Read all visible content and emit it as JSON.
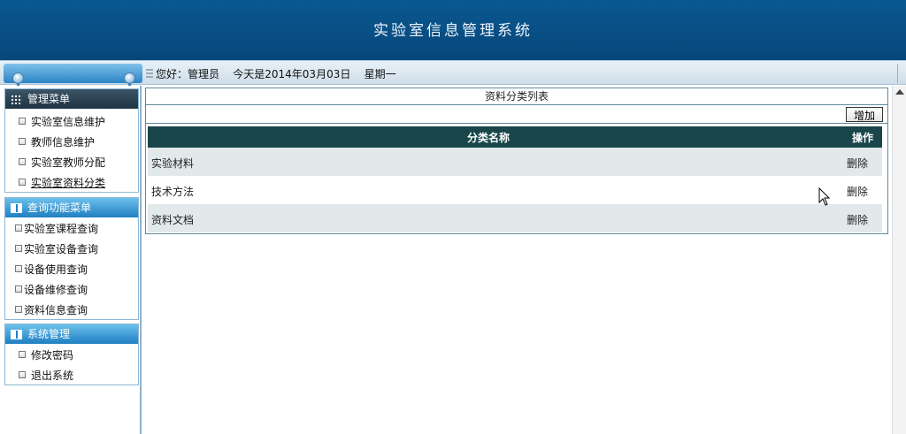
{
  "header": {
    "title": "实验室信息管理系统"
  },
  "welcome": {
    "text": "您好：管理员    今天是2014年03月03日    星期一"
  },
  "sidebar": {
    "admin_menu": {
      "title": "管理菜单",
      "items": [
        "实验室信息维护",
        "教师信息维护",
        "实验室教师分配",
        "实验室资料分类"
      ]
    },
    "query_menu": {
      "title": "查询功能菜单",
      "items": [
        "实验室课程查询",
        "实验室设备查询",
        "设备使用查询",
        "设备维修查询",
        "资料信息查询"
      ]
    },
    "system_menu": {
      "title": "系统管理",
      "items": [
        "修改密码",
        "退出系统"
      ]
    }
  },
  "panel": {
    "title": "资料分类列表",
    "add_label": "增加",
    "columns": [
      "分类名称",
      "操作"
    ],
    "rows": [
      {
        "name": "实验材料",
        "action": "删除"
      },
      {
        "name": "技术方法",
        "action": "删除"
      },
      {
        "name": "资料文档",
        "action": "删除"
      }
    ]
  },
  "colors": {
    "banner": "#0a5891",
    "table_header": "#18464b",
    "row_alt": "#e1e9ea"
  }
}
